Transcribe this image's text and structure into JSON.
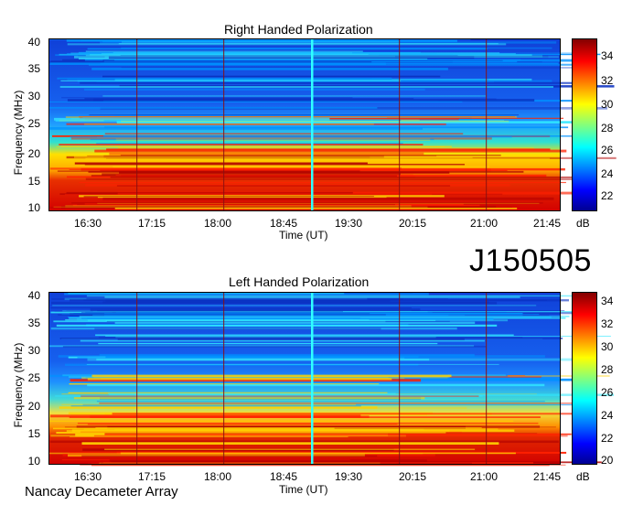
{
  "stamp": "J150505",
  "footer": "Nancay Decameter Array",
  "chart_data": [
    {
      "type": "heatmap",
      "title": "Right Handed Polarization",
      "xlabel": "Time (UT)",
      "ylabel": "Frequency (MHz)",
      "xticks": [
        "16:30",
        "17:15",
        "18:00",
        "18:45",
        "19:30",
        "20:15",
        "21:00",
        "21:45"
      ],
      "yticks": [
        "10",
        "15",
        "20",
        "25",
        "30",
        "35",
        "40"
      ],
      "ylim": [
        10,
        40
      ],
      "colorbar": {
        "label": "dB",
        "range": [
          21,
          35
        ],
        "ticks": [
          "22",
          "24",
          "26",
          "28",
          "30",
          "32",
          "34"
        ]
      }
    },
    {
      "type": "heatmap",
      "title": "Left Handed Polarization",
      "xlabel": "Time (UT)",
      "ylabel": "Frequency (MHz)",
      "xticks": [
        "16:30",
        "17:15",
        "18:00",
        "18:45",
        "19:30",
        "20:15",
        "21:00",
        "21:45"
      ],
      "yticks": [
        "10",
        "15",
        "20",
        "25",
        "30",
        "35",
        "40"
      ],
      "ylim": [
        10,
        40
      ],
      "colorbar": {
        "label": "dB",
        "range": [
          20,
          35
        ],
        "ticks": [
          "20",
          "22",
          "24",
          "26",
          "28",
          "30",
          "32",
          "34"
        ]
      }
    }
  ]
}
